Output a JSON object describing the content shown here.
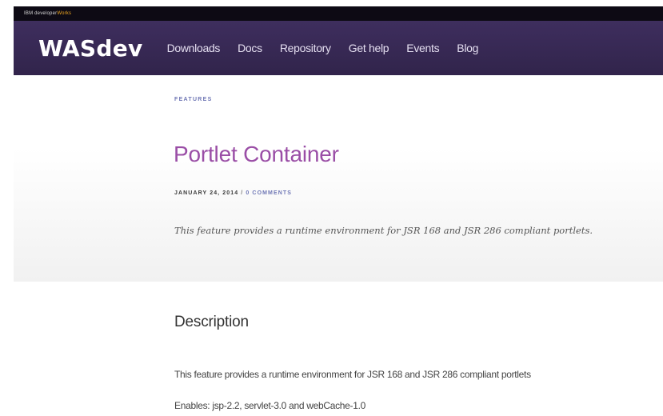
{
  "top_bar": {
    "brand_prefix": "IBM",
    "brand_middle": " developer",
    "brand_accent": "Works"
  },
  "header": {
    "logo": "WASdev",
    "nav": [
      {
        "label": "Downloads"
      },
      {
        "label": "Docs"
      },
      {
        "label": "Repository"
      },
      {
        "label": "Get help"
      },
      {
        "label": "Events"
      },
      {
        "label": "Blog"
      }
    ]
  },
  "article": {
    "category": "FEATURES",
    "title": "Portlet Container",
    "date": "JANUARY 24, 2014",
    "separator": " / ",
    "comments": "0 COMMENTS",
    "summary": "This feature provides a runtime environment for JSR 168 and JSR 286 compliant portlets."
  },
  "description": {
    "heading": "Description",
    "text": "This feature provides a runtime environment for JSR 168 and JSR 286 compliant portlets",
    "enables": "Enables: jsp-2.2, servlet-3.0 and webCache-1.0"
  }
}
